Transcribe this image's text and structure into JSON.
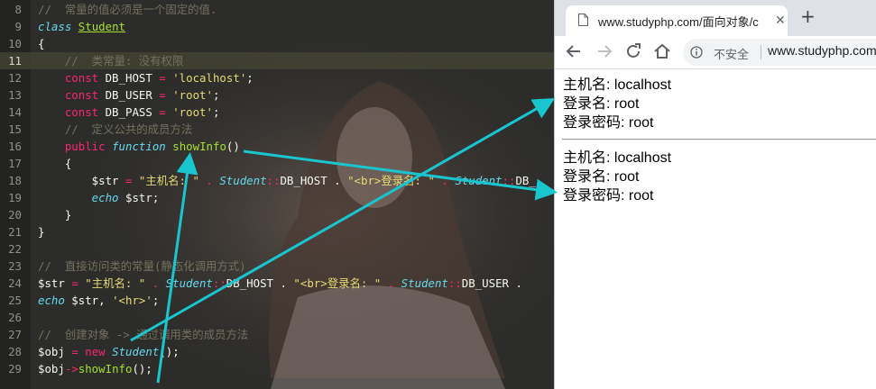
{
  "editor": {
    "lines": [
      {
        "num": "8",
        "current": false,
        "tokens": [
          {
            "t": "//  常量的值必须是一个固定的值.",
            "c": "c"
          }
        ]
      },
      {
        "num": "9",
        "current": false,
        "tokens": [
          {
            "t": "class",
            "c": "ki"
          },
          {
            "t": " ",
            "c": ""
          },
          {
            "t": "Student",
            "c": "ku"
          }
        ]
      },
      {
        "num": "10",
        "current": false,
        "tokens": [
          {
            "t": "{",
            "c": ""
          }
        ]
      },
      {
        "num": "11",
        "current": true,
        "tokens": [
          {
            "t": "    //  类常量: 没有权限",
            "c": "c"
          }
        ]
      },
      {
        "num": "12",
        "current": false,
        "tokens": [
          {
            "t": "    const",
            "c": "k"
          },
          {
            "t": " DB_HOST ",
            "c": ""
          },
          {
            "t": "=",
            "c": "p"
          },
          {
            "t": " ",
            "c": ""
          },
          {
            "t": "'localhost'",
            "c": "s"
          },
          {
            "t": ";",
            "c": ""
          }
        ]
      },
      {
        "num": "13",
        "current": false,
        "tokens": [
          {
            "t": "    const",
            "c": "k"
          },
          {
            "t": " DB_USER ",
            "c": ""
          },
          {
            "t": "=",
            "c": "p"
          },
          {
            "t": " ",
            "c": ""
          },
          {
            "t": "'root'",
            "c": "s"
          },
          {
            "t": ";",
            "c": ""
          }
        ]
      },
      {
        "num": "14",
        "current": false,
        "tokens": [
          {
            "t": "    const",
            "c": "k"
          },
          {
            "t": " DB_PASS ",
            "c": ""
          },
          {
            "t": "=",
            "c": "p"
          },
          {
            "t": " ",
            "c": ""
          },
          {
            "t": "'root'",
            "c": "s"
          },
          {
            "t": ";",
            "c": ""
          }
        ]
      },
      {
        "num": "15",
        "current": false,
        "tokens": [
          {
            "t": "    //  定义公共的成员方法",
            "c": "c"
          }
        ]
      },
      {
        "num": "16",
        "current": false,
        "tokens": [
          {
            "t": "    public",
            "c": "k"
          },
          {
            "t": " ",
            "c": ""
          },
          {
            "t": "function",
            "c": "ki"
          },
          {
            "t": " ",
            "c": ""
          },
          {
            "t": "showInfo",
            "c": "f"
          },
          {
            "t": "()",
            "c": ""
          }
        ]
      },
      {
        "num": "17",
        "current": false,
        "tokens": [
          {
            "t": "    {",
            "c": ""
          }
        ]
      },
      {
        "num": "18",
        "current": false,
        "tokens": [
          {
            "t": "        $str ",
            "c": ""
          },
          {
            "t": "=",
            "c": "p"
          },
          {
            "t": " ",
            "c": ""
          },
          {
            "t": "\"主机名: \"",
            "c": "s"
          },
          {
            "t": " . ",
            "c": "p"
          },
          {
            "t": "Student",
            "c": "st"
          },
          {
            "t": "::",
            "c": "p"
          },
          {
            "t": "DB_HOST . ",
            "c": ""
          },
          {
            "t": "\"<br>登录名: \"",
            "c": "s"
          },
          {
            "t": " . ",
            "c": "p"
          },
          {
            "t": "Student",
            "c": "st"
          },
          {
            "t": "::",
            "c": "p"
          },
          {
            "t": "DB_",
            "c": ""
          }
        ]
      },
      {
        "num": "19",
        "current": false,
        "tokens": [
          {
            "t": "        echo",
            "c": "ki"
          },
          {
            "t": " $str;",
            "c": ""
          }
        ]
      },
      {
        "num": "20",
        "current": false,
        "tokens": [
          {
            "t": "    }",
            "c": ""
          }
        ]
      },
      {
        "num": "21",
        "current": false,
        "tokens": [
          {
            "t": "}",
            "c": ""
          }
        ]
      },
      {
        "num": "22",
        "current": false,
        "tokens": []
      },
      {
        "num": "23",
        "current": false,
        "tokens": [
          {
            "t": "//  直接访问类的常量(静态化调用方式)",
            "c": "c"
          }
        ]
      },
      {
        "num": "24",
        "current": false,
        "tokens": [
          {
            "t": "$str ",
            "c": ""
          },
          {
            "t": "=",
            "c": "p"
          },
          {
            "t": " ",
            "c": ""
          },
          {
            "t": "\"主机名: \"",
            "c": "s"
          },
          {
            "t": " . ",
            "c": "p"
          },
          {
            "t": "Student",
            "c": "st"
          },
          {
            "t": "::",
            "c": "p"
          },
          {
            "t": "DB_HOST . ",
            "c": ""
          },
          {
            "t": "\"<br>登录名: \"",
            "c": "s"
          },
          {
            "t": " . ",
            "c": "p"
          },
          {
            "t": "Student",
            "c": "st"
          },
          {
            "t": "::",
            "c": "p"
          },
          {
            "t": "DB_USER .",
            "c": ""
          }
        ]
      },
      {
        "num": "25",
        "current": false,
        "tokens": [
          {
            "t": "echo",
            "c": "ki"
          },
          {
            "t": " $str, ",
            "c": ""
          },
          {
            "t": "'<hr>'",
            "c": "s"
          },
          {
            "t": ";",
            "c": ""
          }
        ]
      },
      {
        "num": "26",
        "current": false,
        "tokens": []
      },
      {
        "num": "27",
        "current": false,
        "tokens": [
          {
            "t": "//  创建对象 -> 通过调用类的成员方法",
            "c": "c"
          }
        ]
      },
      {
        "num": "28",
        "current": false,
        "tokens": [
          {
            "t": "$obj ",
            "c": ""
          },
          {
            "t": "=",
            "c": "p"
          },
          {
            "t": " ",
            "c": ""
          },
          {
            "t": "new",
            "c": "k"
          },
          {
            "t": " ",
            "c": ""
          },
          {
            "t": "Student",
            "c": "st"
          },
          {
            "t": "();",
            "c": ""
          }
        ]
      },
      {
        "num": "29",
        "current": false,
        "tokens": [
          {
            "t": "$obj",
            "c": ""
          },
          {
            "t": "->",
            "c": "p"
          },
          {
            "t": "showInfo",
            "c": "f"
          },
          {
            "t": "();",
            "c": ""
          }
        ]
      }
    ]
  },
  "browser": {
    "tab_title": "www.studyphp.com/面向对象/c",
    "tab_close": "✕",
    "new_tab": "+",
    "security_label": "不安全",
    "url": "www.studyphp.com",
    "output_first": [
      "主机名: localhost",
      "登录名: root",
      "登录密码: root"
    ],
    "output_second": [
      "主机名: localhost",
      "登录名: root",
      "登录密码: root"
    ]
  },
  "colors": {
    "annotation_arrow": "#19c6cf",
    "editor_bg": "#2c2c2a",
    "comment": "#75715e",
    "keyword": "#f92672",
    "string": "#e6db74"
  }
}
